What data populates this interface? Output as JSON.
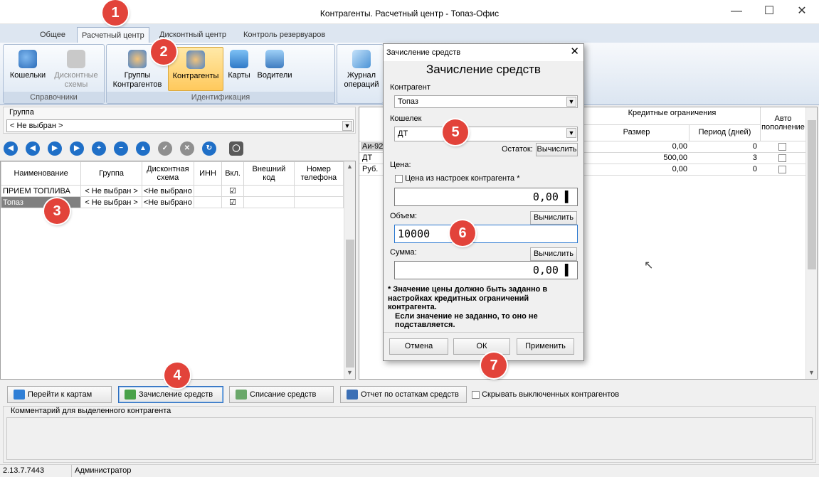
{
  "window": {
    "title": "Контрагенты. Расчетный центр - Топаз-Офис"
  },
  "ribbon_tabs": [
    "Общее",
    "Расчетный центр",
    "Дисконтный центр",
    "Контроль резервуаров"
  ],
  "ribbon": {
    "groups": {
      "spravochniki": "Справочники",
      "identifikaciya": "Идентификация"
    },
    "buttons": {
      "wallets": "Кошельки",
      "discount_schemes": "Дисконтные схемы",
      "contractor_groups": "Группы Контрагентов",
      "contractors": "Контрагенты",
      "cards": "Карты",
      "drivers": "Водители",
      "operations_log": "Журнал операций"
    }
  },
  "left": {
    "group_label": "Группа",
    "group_value": "< Не выбран >",
    "table": {
      "headers": [
        "Наименование",
        "Группа",
        "Дисконтная схема",
        "ИНН",
        "Вкл.",
        "Внешний код",
        "Номер телефона"
      ],
      "rows": [
        {
          "name": "ПРИЕМ ТОПЛИВА",
          "group": "< Не выбран >",
          "scheme": "<Не выбрано",
          "inn": "",
          "enabled": "☑",
          "ext": "",
          "phone": ""
        },
        {
          "name": "Топаз",
          "group": "< Не выбран >",
          "scheme": "<Не выбрано",
          "inn": "",
          "enabled": "☑",
          "ext": "",
          "phone": ""
        }
      ]
    }
  },
  "right": {
    "headers": {
      "credit": "Кредитные ограничения",
      "size": "Размер",
      "period": "Период (дней)",
      "auto": "Авто пополнение"
    },
    "rows": [
      {
        "wallet": "Аи-92",
        "size": "0,00",
        "period": "0"
      },
      {
        "wallet": "ДТ",
        "size": "500,00",
        "period": "3"
      },
      {
        "wallet": "Руб.",
        "size": "0,00",
        "period": "0"
      }
    ]
  },
  "bottom": {
    "go_to_cards": "Перейти к картам",
    "credit_funds": "Зачисление средств",
    "debit_funds": "Списание средств",
    "balance_report": "Отчет по остаткам средств",
    "hide_disabled": "Скрывать выключенных контрагентов",
    "comment_label": "Комментарий для выделенного контрагента"
  },
  "status": {
    "version": "2.13.7.7443",
    "user": "Администратор"
  },
  "dialog": {
    "title": "Зачисление средств",
    "heading": "Зачисление средств",
    "contractor_label": "Контрагент",
    "contractor_value": "Топаз",
    "wallet_label": "Кошелек",
    "wallet_value": "ДТ",
    "balance_label": "Остаток:",
    "calc": "Вычислить",
    "price_label": "Цена:",
    "price_from_settings": "Цена из настроек контрагента *",
    "price_value": "0,00",
    "volume_label": "Объем:",
    "volume_value": "10000",
    "sum_label": "Сумма:",
    "sum_value": "0,00",
    "note1": "* Значение цены должно быть заданно в настройках кредитных ограничений контрагента.",
    "note2": "Если значение не заданно, то оно не подставляется.",
    "cancel": "Отмена",
    "ok": "ОК",
    "apply": "Применить"
  },
  "badges": [
    "1",
    "2",
    "3",
    "4",
    "5",
    "6",
    "7"
  ]
}
